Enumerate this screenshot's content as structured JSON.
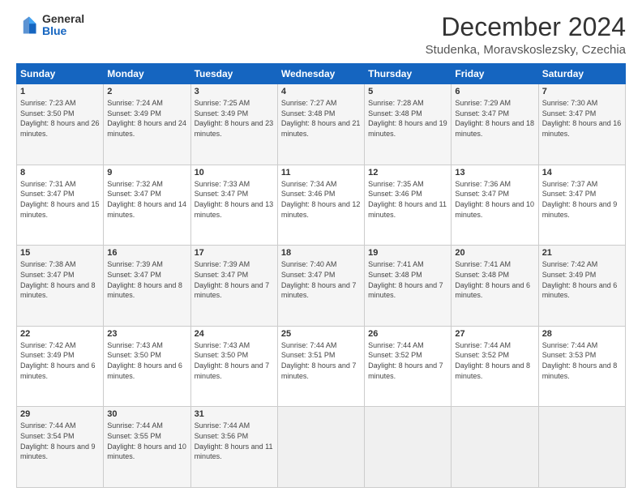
{
  "header": {
    "logo_general": "General",
    "logo_blue": "Blue",
    "title": "December 2024",
    "subtitle": "Studenka, Moravskoslezsky, Czechia"
  },
  "days_of_week": [
    "Sunday",
    "Monday",
    "Tuesday",
    "Wednesday",
    "Thursday",
    "Friday",
    "Saturday"
  ],
  "weeks": [
    [
      {
        "day": 1,
        "sunrise": "7:23 AM",
        "sunset": "3:50 PM",
        "daylight": "8 hours and 26 minutes."
      },
      {
        "day": 2,
        "sunrise": "7:24 AM",
        "sunset": "3:49 PM",
        "daylight": "8 hours and 24 minutes."
      },
      {
        "day": 3,
        "sunrise": "7:25 AM",
        "sunset": "3:49 PM",
        "daylight": "8 hours and 23 minutes."
      },
      {
        "day": 4,
        "sunrise": "7:27 AM",
        "sunset": "3:48 PM",
        "daylight": "8 hours and 21 minutes."
      },
      {
        "day": 5,
        "sunrise": "7:28 AM",
        "sunset": "3:48 PM",
        "daylight": "8 hours and 19 minutes."
      },
      {
        "day": 6,
        "sunrise": "7:29 AM",
        "sunset": "3:47 PM",
        "daylight": "8 hours and 18 minutes."
      },
      {
        "day": 7,
        "sunrise": "7:30 AM",
        "sunset": "3:47 PM",
        "daylight": "8 hours and 16 minutes."
      }
    ],
    [
      {
        "day": 8,
        "sunrise": "7:31 AM",
        "sunset": "3:47 PM",
        "daylight": "8 hours and 15 minutes."
      },
      {
        "day": 9,
        "sunrise": "7:32 AM",
        "sunset": "3:47 PM",
        "daylight": "8 hours and 14 minutes."
      },
      {
        "day": 10,
        "sunrise": "7:33 AM",
        "sunset": "3:47 PM",
        "daylight": "8 hours and 13 minutes."
      },
      {
        "day": 11,
        "sunrise": "7:34 AM",
        "sunset": "3:46 PM",
        "daylight": "8 hours and 12 minutes."
      },
      {
        "day": 12,
        "sunrise": "7:35 AM",
        "sunset": "3:46 PM",
        "daylight": "8 hours and 11 minutes."
      },
      {
        "day": 13,
        "sunrise": "7:36 AM",
        "sunset": "3:47 PM",
        "daylight": "8 hours and 10 minutes."
      },
      {
        "day": 14,
        "sunrise": "7:37 AM",
        "sunset": "3:47 PM",
        "daylight": "8 hours and 9 minutes."
      }
    ],
    [
      {
        "day": 15,
        "sunrise": "7:38 AM",
        "sunset": "3:47 PM",
        "daylight": "8 hours and 8 minutes."
      },
      {
        "day": 16,
        "sunrise": "7:39 AM",
        "sunset": "3:47 PM",
        "daylight": "8 hours and 8 minutes."
      },
      {
        "day": 17,
        "sunrise": "7:39 AM",
        "sunset": "3:47 PM",
        "daylight": "8 hours and 7 minutes."
      },
      {
        "day": 18,
        "sunrise": "7:40 AM",
        "sunset": "3:47 PM",
        "daylight": "8 hours and 7 minutes."
      },
      {
        "day": 19,
        "sunrise": "7:41 AM",
        "sunset": "3:48 PM",
        "daylight": "8 hours and 7 minutes."
      },
      {
        "day": 20,
        "sunrise": "7:41 AM",
        "sunset": "3:48 PM",
        "daylight": "8 hours and 6 minutes."
      },
      {
        "day": 21,
        "sunrise": "7:42 AM",
        "sunset": "3:49 PM",
        "daylight": "8 hours and 6 minutes."
      }
    ],
    [
      {
        "day": 22,
        "sunrise": "7:42 AM",
        "sunset": "3:49 PM",
        "daylight": "8 hours and 6 minutes."
      },
      {
        "day": 23,
        "sunrise": "7:43 AM",
        "sunset": "3:50 PM",
        "daylight": "8 hours and 6 minutes."
      },
      {
        "day": 24,
        "sunrise": "7:43 AM",
        "sunset": "3:50 PM",
        "daylight": "8 hours and 7 minutes."
      },
      {
        "day": 25,
        "sunrise": "7:44 AM",
        "sunset": "3:51 PM",
        "daylight": "8 hours and 7 minutes."
      },
      {
        "day": 26,
        "sunrise": "7:44 AM",
        "sunset": "3:52 PM",
        "daylight": "8 hours and 7 minutes."
      },
      {
        "day": 27,
        "sunrise": "7:44 AM",
        "sunset": "3:52 PM",
        "daylight": "8 hours and 8 minutes."
      },
      {
        "day": 28,
        "sunrise": "7:44 AM",
        "sunset": "3:53 PM",
        "daylight": "8 hours and 8 minutes."
      }
    ],
    [
      {
        "day": 29,
        "sunrise": "7:44 AM",
        "sunset": "3:54 PM",
        "daylight": "8 hours and 9 minutes."
      },
      {
        "day": 30,
        "sunrise": "7:44 AM",
        "sunset": "3:55 PM",
        "daylight": "8 hours and 10 minutes."
      },
      {
        "day": 31,
        "sunrise": "7:44 AM",
        "sunset": "3:56 PM",
        "daylight": "8 hours and 11 minutes."
      },
      null,
      null,
      null,
      null
    ]
  ]
}
